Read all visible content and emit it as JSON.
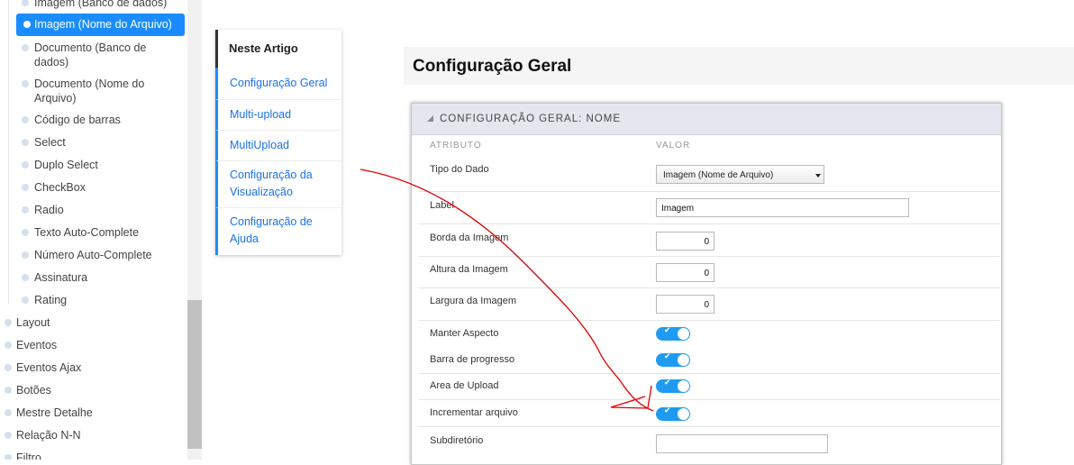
{
  "sidebar": {
    "sub_items": [
      {
        "label": "Imagem (Banco de dados)"
      },
      {
        "label": "Imagem (Nome do Arquivo)",
        "active": true
      },
      {
        "label": "Documento (Banco de dados)"
      },
      {
        "label": "Documento (Nome do Arquivo)"
      },
      {
        "label": "Código de barras"
      },
      {
        "label": "Select"
      },
      {
        "label": "Duplo Select"
      },
      {
        "label": "CheckBox"
      },
      {
        "label": "Radio"
      },
      {
        "label": "Texto Auto-Complete"
      },
      {
        "label": "Número Auto-Complete"
      },
      {
        "label": "Assinatura"
      },
      {
        "label": "Rating"
      }
    ],
    "top_items": [
      {
        "label": "Layout"
      },
      {
        "label": "Eventos"
      },
      {
        "label": "Eventos Ajax"
      },
      {
        "label": "Botões"
      },
      {
        "label": "Mestre Detalhe"
      },
      {
        "label": "Relação N-N"
      },
      {
        "label": "Filtro"
      }
    ]
  },
  "toc": {
    "title": "Neste Artigo",
    "links": [
      {
        "label": "Configuração Geral"
      },
      {
        "label": "Multi-upload"
      },
      {
        "label": "MultiUpload"
      },
      {
        "label": "Configuração da Visualização"
      },
      {
        "label": "Configuração de Ajuda"
      }
    ]
  },
  "section": {
    "title": "Configuração Geral"
  },
  "panel": {
    "title": "CONFIGURAÇÃO GERAL: NOME",
    "col_attribute": "ATRIBUTO",
    "col_value": "VALOR",
    "rows": [
      {
        "label": "Tipo do Dado",
        "type": "select",
        "value": "Imagem (Nome de Arquivo)"
      },
      {
        "label": "Label",
        "type": "text",
        "value": "Imagem"
      },
      {
        "label": "Borda da Imagem",
        "type": "number",
        "value": "0"
      },
      {
        "label": "Altura da Imagem",
        "type": "number",
        "value": "0"
      },
      {
        "label": "Largura da Imagem",
        "type": "number",
        "value": "0"
      },
      {
        "label": "Manter Aspecto",
        "type": "toggle",
        "value": true
      },
      {
        "label": "Barra de progresso",
        "type": "toggle",
        "value": true
      },
      {
        "label": "Area de Upload",
        "type": "toggle",
        "value": true
      },
      {
        "label": "Incrementar arquivo",
        "type": "toggle",
        "value": true
      },
      {
        "label": "Subdiretório",
        "type": "text",
        "value": ""
      }
    ]
  },
  "colors": {
    "accent": "#1a8cff",
    "toggle_on": "#1e9bf0",
    "annotation": "#e00000"
  },
  "icons": {
    "sidebar_bullet": "dot-icon",
    "collapse": "triangle-collapse-icon",
    "select_arrow": "caret-down-icon",
    "toggle_check": "check-icon"
  }
}
